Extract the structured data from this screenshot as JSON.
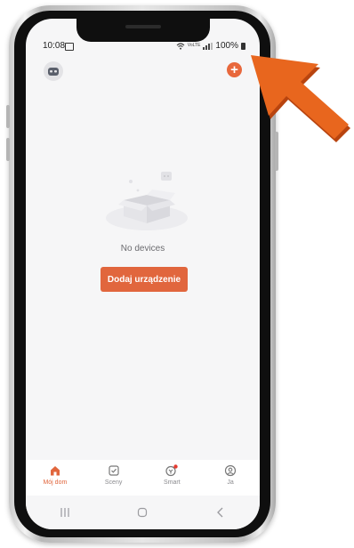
{
  "status_bar": {
    "time": "10:08",
    "battery": "100%"
  },
  "header": {
    "avatar_icon": "robot-avatar-icon",
    "add_icon": "plus-icon",
    "add_symbol": "+"
  },
  "empty_state": {
    "message": "No devices",
    "button_label": "Dodaj urządzenie"
  },
  "tabs": [
    {
      "label": "Mój dom",
      "icon": "home-icon",
      "active": true
    },
    {
      "label": "Sceny",
      "icon": "checkbox-icon",
      "active": false
    },
    {
      "label": "Smart",
      "icon": "smart-icon",
      "active": false,
      "badge": true
    },
    {
      "label": "Ja",
      "icon": "user-icon",
      "active": false
    }
  ],
  "colors": {
    "accent": "#e1663d",
    "arrow": "#e8661e",
    "screen_bg": "#f6f6f7"
  }
}
